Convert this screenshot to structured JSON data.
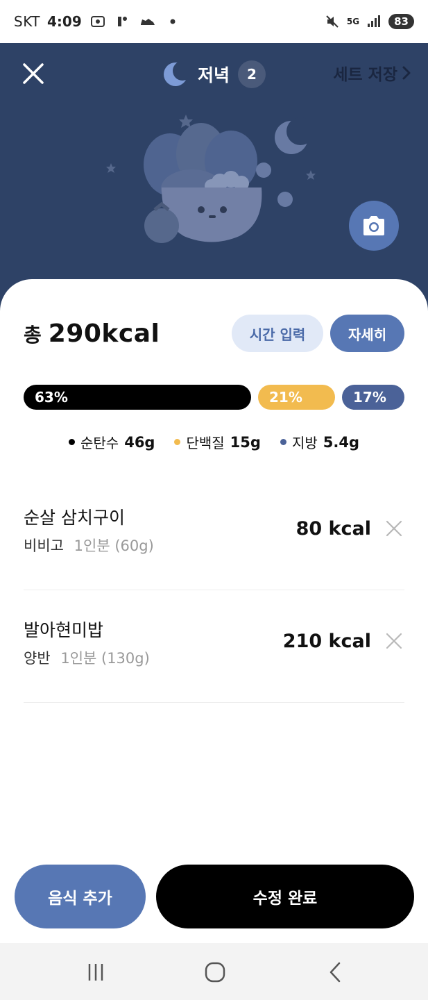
{
  "status_bar": {
    "carrier": "SKT",
    "time": "4:09",
    "network": "5G",
    "battery": "83"
  },
  "header": {
    "title": "저녁",
    "meal_count": "2",
    "set_save_label": "세트 저장",
    "background_color": "#2e4266"
  },
  "summary": {
    "total_prefix": "총",
    "total_value": "290kcal",
    "time_button": "시간 입력",
    "detail_button": "자세히"
  },
  "macros": {
    "bars": [
      {
        "label": "63%",
        "percent": 63,
        "color": "#000000"
      },
      {
        "label": "21%",
        "percent": 21,
        "color": "#f2bb4f"
      },
      {
        "label": "17%",
        "percent": 17,
        "color": "#4b6298"
      }
    ],
    "legend": [
      {
        "name": "순탄수",
        "value": "46g",
        "color": "#000000"
      },
      {
        "name": "단백질",
        "value": "15g",
        "color": "#f2bb4f"
      },
      {
        "name": "지방",
        "value": "5.4g",
        "color": "#4b6298"
      }
    ]
  },
  "foods": [
    {
      "name": "순살 삼치구이",
      "brand": "비비고",
      "serving": "1인분 (60g)",
      "kcal": "80 kcal"
    },
    {
      "name": "발아현미밥",
      "brand": "양반",
      "serving": "1인분 (130g)",
      "kcal": "210 kcal"
    }
  ],
  "actions": {
    "add_food": "음식 추가",
    "done": "수정 완료"
  },
  "colors": {
    "accent": "#5777b4",
    "accent_light": "#e1e9f7",
    "carb": "#000000",
    "protein": "#f2bb4f",
    "fat": "#4b6298"
  }
}
